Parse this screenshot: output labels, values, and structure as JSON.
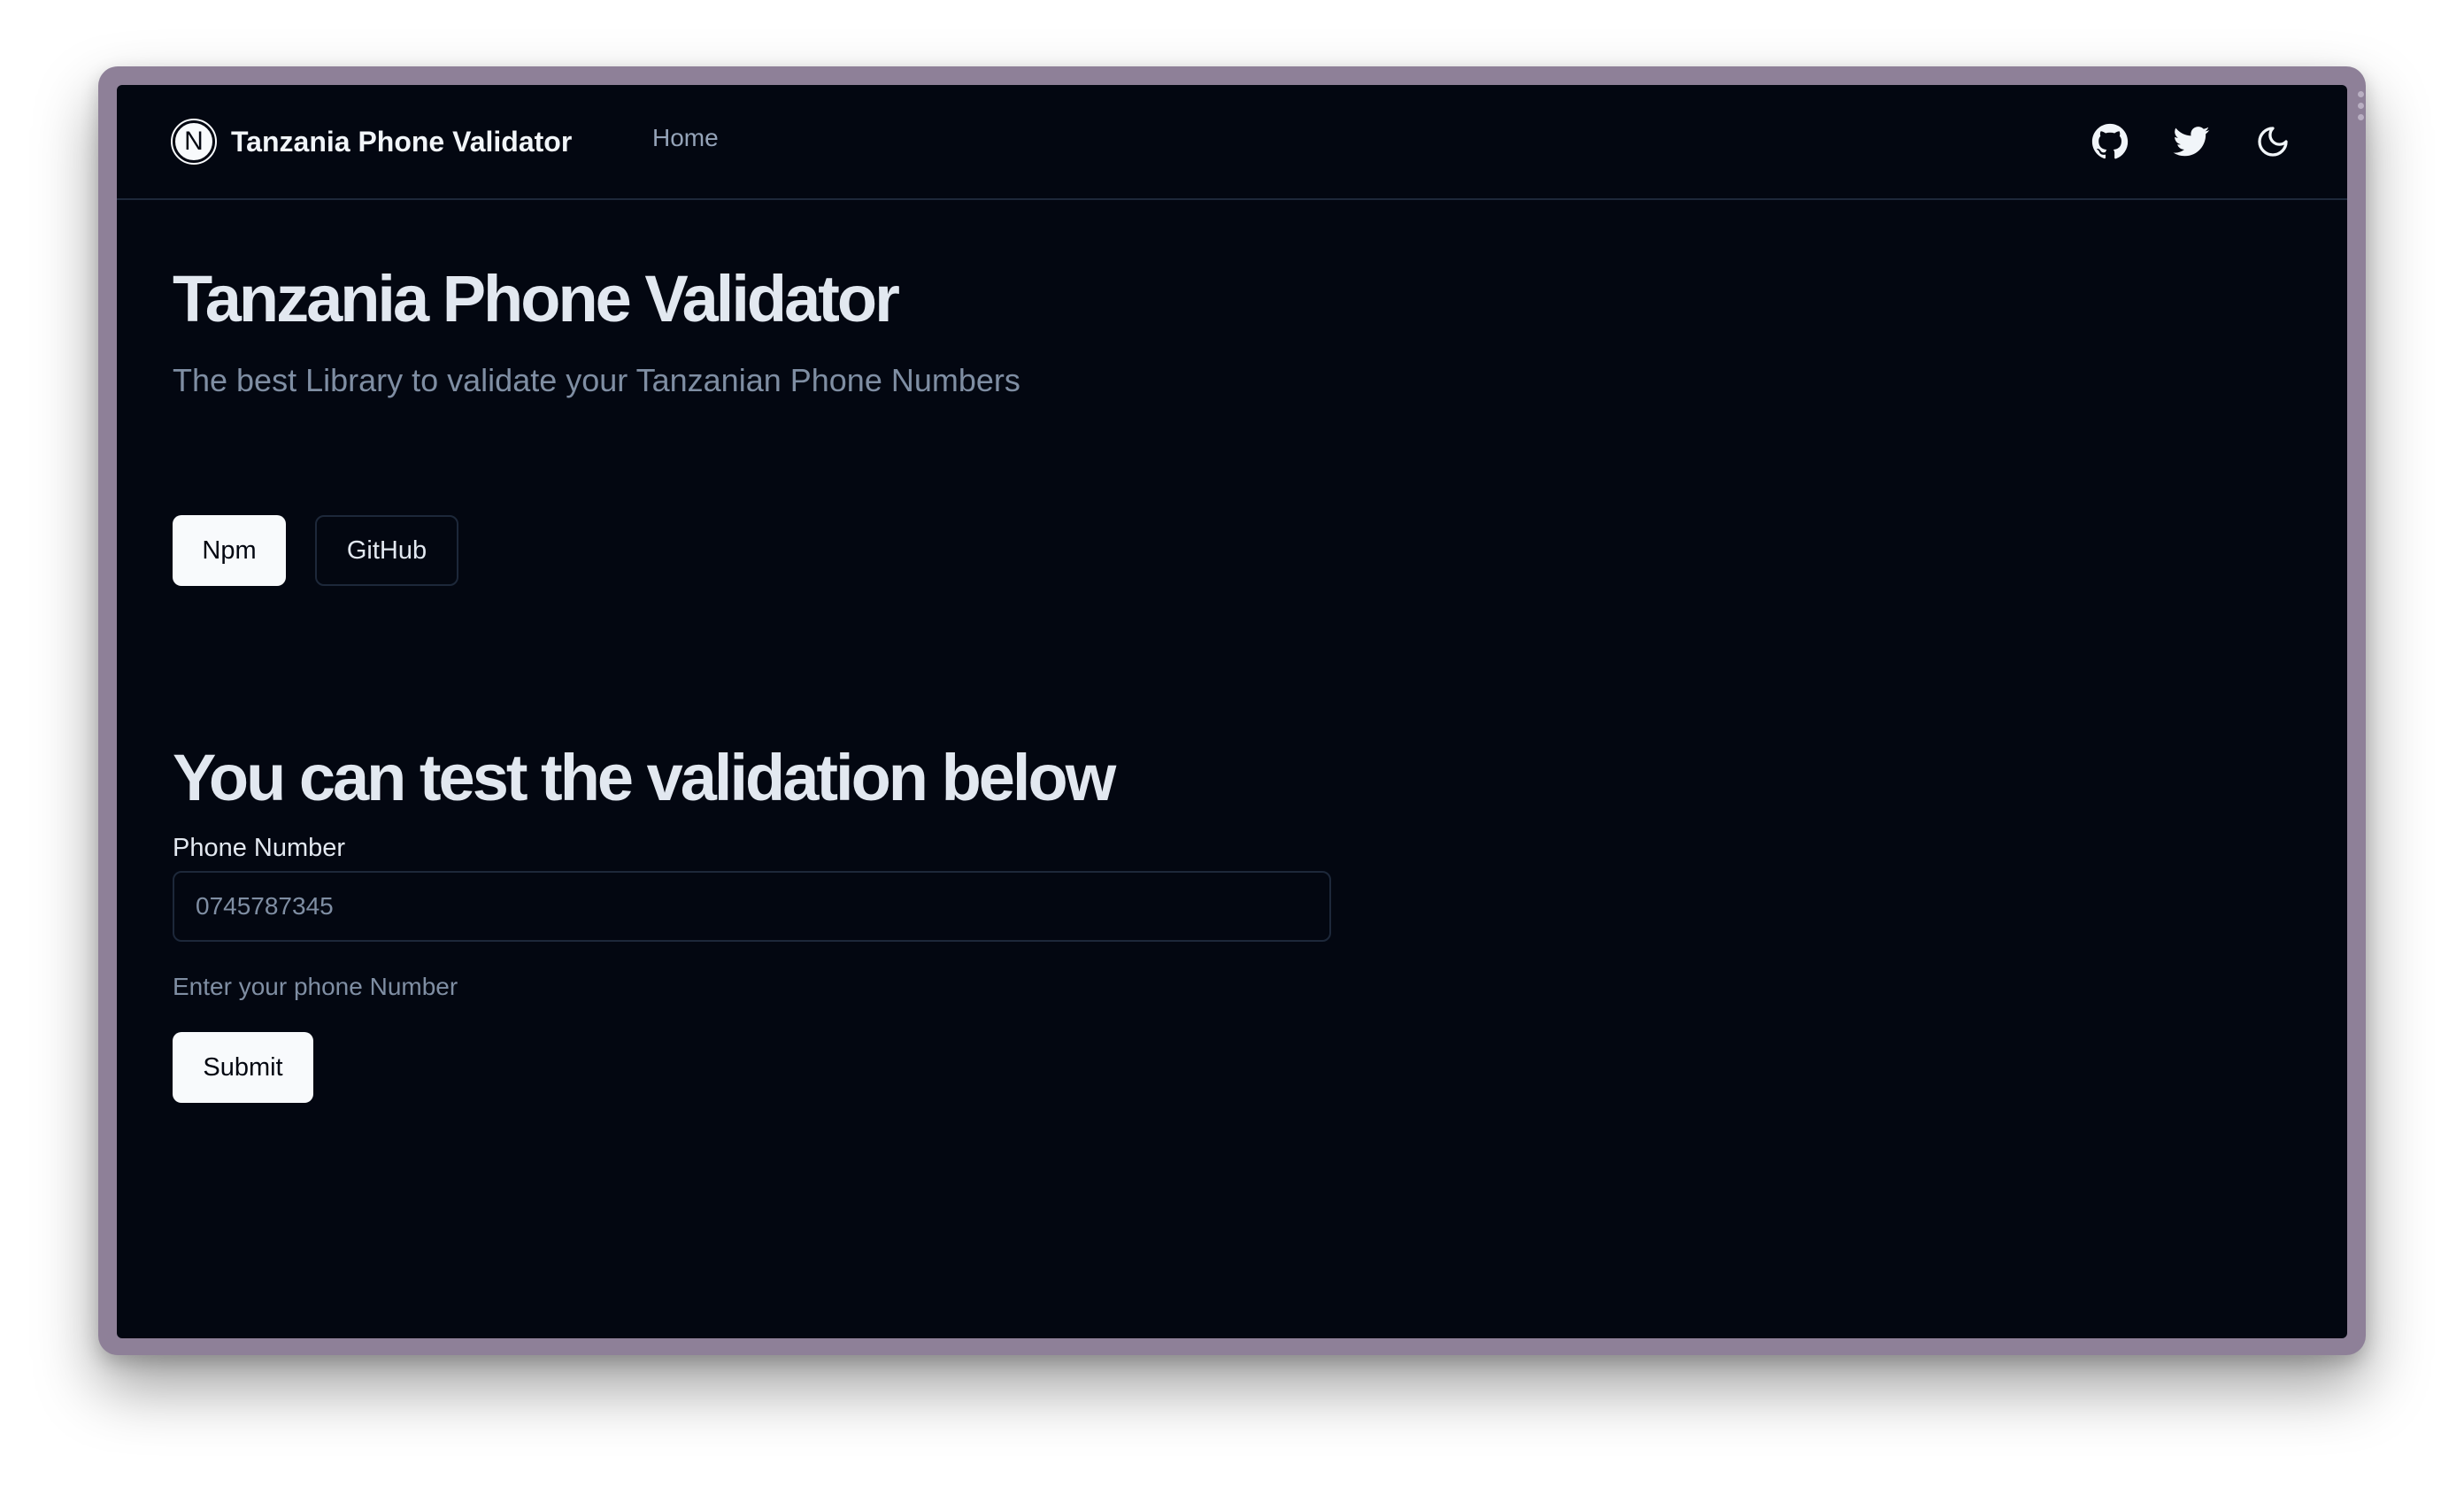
{
  "nav": {
    "logo_letter": "N",
    "brand_title": "Tanzania Phone Validator",
    "links": [
      {
        "label": "Home"
      }
    ],
    "icons": [
      "github-icon",
      "twitter-icon",
      "moon-icon"
    ]
  },
  "hero": {
    "title": "Tanzania Phone Validator",
    "subtitle": "The best Library to validate your Tanzanian Phone Numbers",
    "buttons": {
      "npm": "Npm",
      "github": "GitHub"
    }
  },
  "form": {
    "section_title": "You can test the validation below",
    "label": "Phone Number",
    "placeholder": "0745787345",
    "value": "",
    "help_text": "Enter your phone Number",
    "submit_label": "Submit"
  },
  "colors": {
    "background": "#030711",
    "frame": "#8e8098",
    "border": "#1d283a",
    "foreground": "#e2e8f0",
    "muted": "#7f8ea3",
    "button_light": "#f8fafc"
  }
}
